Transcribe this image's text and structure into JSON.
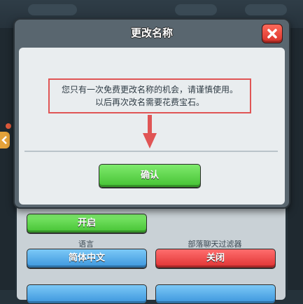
{
  "dialog": {
    "title": "更改名称",
    "message_line1": "您只有一次免费更改名称的机会，请谨慎使用。",
    "message_line2": "以后再次改名需要花费宝石。",
    "confirm_label": "确认"
  },
  "settings": {
    "toggle_label": "开启",
    "language_title": "语言",
    "language_value": "简体中文",
    "filter_title": "部落聊天过滤器",
    "filter_value": "关闭"
  },
  "icons": {
    "close": "close-icon",
    "pointer": "arrow-up-icon",
    "side": "chevron-left-icon"
  },
  "colors": {
    "confirm_green": "#45c233",
    "highlight_red": "#e05555",
    "close_red": "#d8322a"
  }
}
